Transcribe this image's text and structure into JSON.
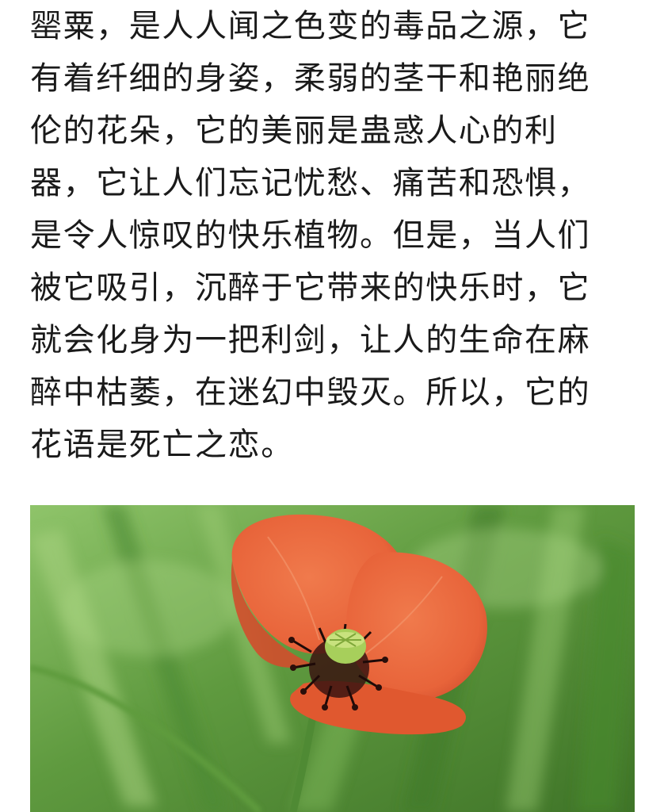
{
  "article": {
    "paragraph_lines": [
      "罂粟，是人人闻之色变的毒品之源，它",
      "有着纤细的身姿，柔弱的茎干和艳丽绝",
      "伦的花朵，它的美丽是蛊惑人心的利",
      "器，它让人们忘记忧愁、痛苦和恐惧，",
      "是令人惊叹的快乐植物。但是，当人们",
      "被它吸引，沉醉于它带来的快乐时，它",
      "就会化身为一把利剑，让人的生命在麻",
      "醉中枯萎，在迷幻中毁灭。所以，它的",
      "花语是死亡之恋。"
    ],
    "image": {
      "subject": "red-poppy-flower",
      "colors": {
        "petal": "#e8643a",
        "petal_dark": "#c9472a",
        "background_green": "#6aa84a",
        "stem": "#4f8a34",
        "pistil": "#b7d86a"
      }
    }
  }
}
